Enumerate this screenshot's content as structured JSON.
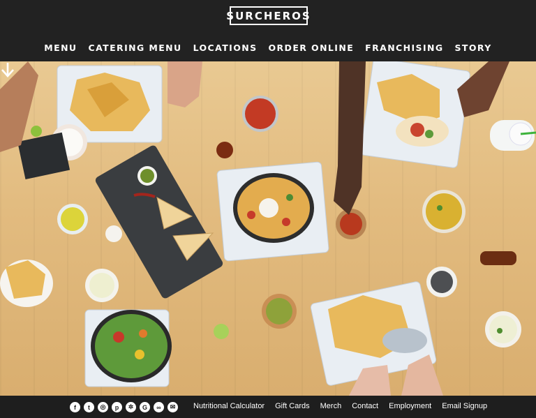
{
  "brand": {
    "logo_text": "SURCHEROS"
  },
  "nav": {
    "items": [
      "MENU",
      "CATERING MENU",
      "LOCATIONS",
      "ORDER ONLINE",
      "FRANCHISING",
      "STORY"
    ]
  },
  "hero": {
    "scroll_icon": "down-arrow-icon"
  },
  "footer": {
    "social_icons": [
      "facebook-icon",
      "twitter-icon",
      "instagram-icon",
      "pinterest-icon",
      "yelp-icon",
      "google-icon",
      "tripadvisor-icon",
      "email-icon"
    ],
    "links": [
      "Nutritional Calculator",
      "Gift Cards",
      "Merch",
      "Contact",
      "Employment",
      "Email Signup"
    ]
  },
  "colors": {
    "header_bg": "#222222",
    "footer_bg": "#1e1e1e",
    "table_wood": "#e2bb7f",
    "text": "#ffffff"
  }
}
